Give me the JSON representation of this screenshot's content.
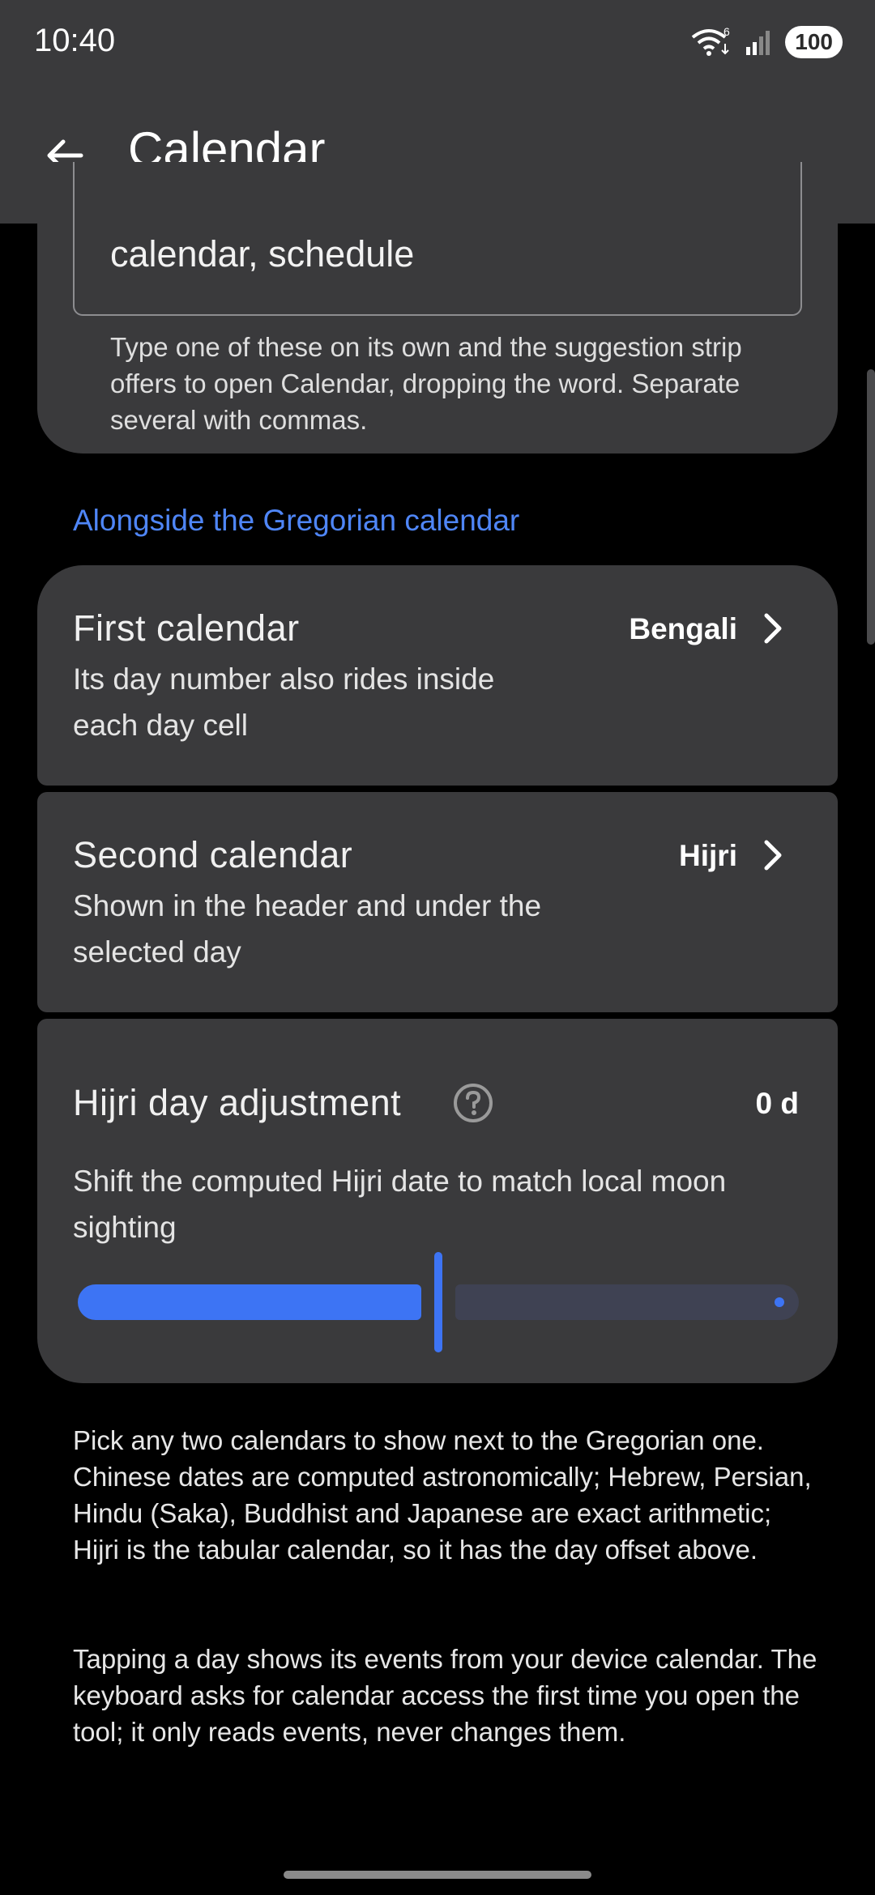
{
  "status_bar": {
    "time": "10:40",
    "battery": "100",
    "wifi_badge": "6"
  },
  "app_bar": {
    "title": "Calendar"
  },
  "keywords": {
    "value": "calendar, schedule",
    "help": "Type one of these on its own and the suggestion strip offers to open Calendar, dropping the word. Separate several with commas."
  },
  "section": {
    "header": "Alongside the Gregorian calendar"
  },
  "first_calendar": {
    "title": "First calendar",
    "subtitle_line1": "Its day number also rides inside",
    "subtitle_line2": "each day cell",
    "value": "Bengali"
  },
  "second_calendar": {
    "title": "Second calendar",
    "subtitle_line1": "Shown in the header and under the",
    "subtitle_line2": "selected day",
    "value": "Hijri"
  },
  "hijri_adjustment": {
    "title": "Hijri day adjustment",
    "value": "0 d",
    "subtitle_line1": "Shift the computed Hijri date to match local moon",
    "subtitle_line2": "sighting",
    "slider_fraction": 0.5
  },
  "footer": {
    "paragraph1": "Pick any two calendars to show next to the Gregorian one. Chinese dates are computed astronomically; Hebrew, Persian, Hindu (Saka), Buddhist and Japanese are exact arithmetic; Hijri is the tabular calendar, so it has the day offset above.",
    "paragraph2": "Tapping a day shows its events from your device calendar. The keyboard asks for calendar access the first time you open the tool; it only reads events, never changes them."
  },
  "colors": {
    "accent": "#4f86f7",
    "card": "#3a3a3c",
    "background": "#000000"
  },
  "icons": [
    "wifi-icon",
    "signal-icon",
    "battery-icon",
    "back-arrow-icon",
    "chevron-right-icon",
    "help-circle-icon"
  ]
}
